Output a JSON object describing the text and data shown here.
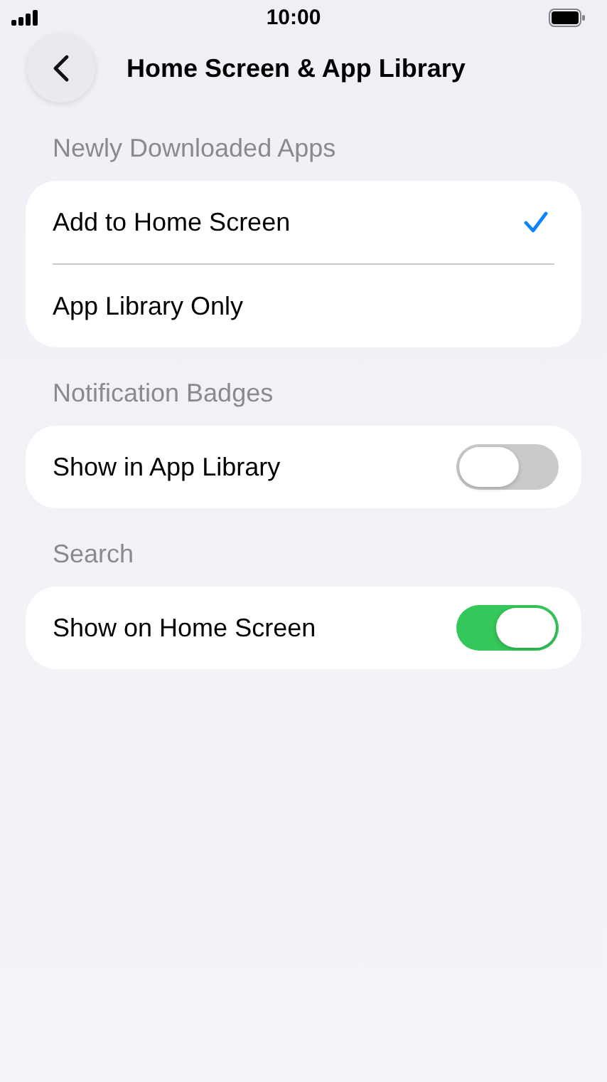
{
  "status_bar": {
    "time": "10:00"
  },
  "nav": {
    "title": "Home Screen & App Library"
  },
  "sections": [
    {
      "header": "Newly Downloaded Apps",
      "rows": [
        {
          "kind": "choice",
          "label": "Add to Home Screen",
          "selected": true
        },
        {
          "kind": "choice",
          "label": "App Library Only",
          "selected": false
        }
      ]
    },
    {
      "header": "Notification Badges",
      "rows": [
        {
          "kind": "toggle",
          "label": "Show in App Library",
          "on": false
        }
      ]
    },
    {
      "header": "Search",
      "rows": [
        {
          "kind": "toggle",
          "label": "Show on Home Screen",
          "on": true
        }
      ]
    }
  ]
}
